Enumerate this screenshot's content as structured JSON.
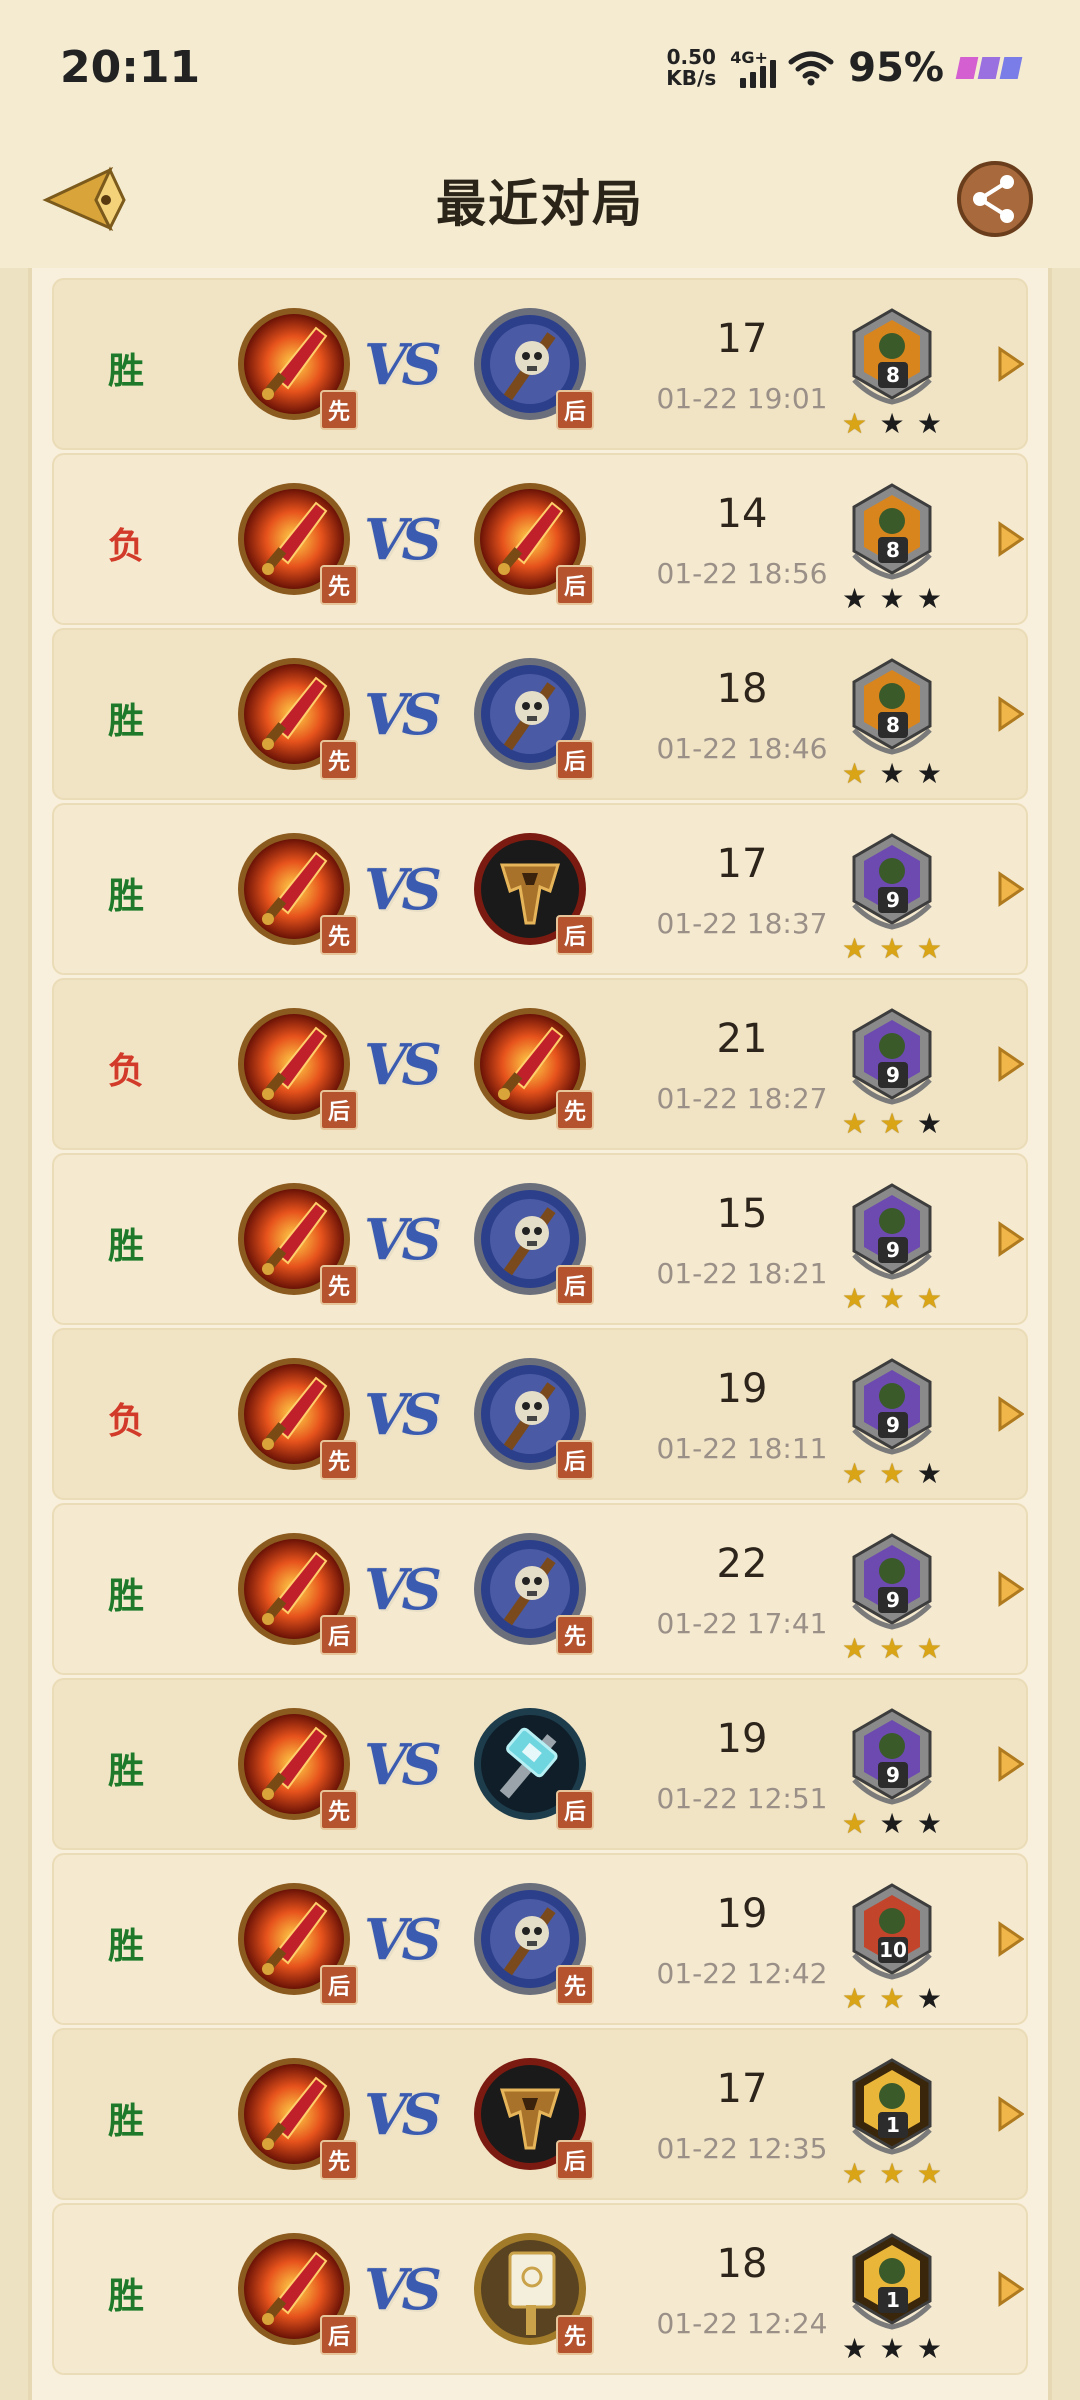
{
  "status_bar": {
    "time": "20:11",
    "speed_value": "0.50",
    "speed_unit": "KB/s",
    "network": "4G+",
    "battery": "95%"
  },
  "header": {
    "title": "最近对局",
    "back_icon": "back-arrow-icon",
    "share_icon": "share-icon"
  },
  "colors": {
    "win": "#1e7a2a",
    "loss": "#d23a2a",
    "star_gold": "#d9a516",
    "star_dark": "#1c1c1c"
  },
  "matches": [
    {
      "result": "胜",
      "my_hero": "fire-blade",
      "my_order": "先",
      "opp_hero": "skull-mace",
      "opp_order": "后",
      "turns": "17",
      "time": "01-22 19:01",
      "rank": "8",
      "rank_style": "orange",
      "stars": [
        1,
        0,
        0
      ]
    },
    {
      "result": "负",
      "my_hero": "fire-blade",
      "my_order": "先",
      "opp_hero": "fire-blade",
      "opp_order": "后",
      "turns": "14",
      "time": "01-22 18:56",
      "rank": "8",
      "rank_style": "orange",
      "stars": [
        0,
        0,
        0
      ]
    },
    {
      "result": "胜",
      "my_hero": "fire-blade",
      "my_order": "先",
      "opp_hero": "skull-mace",
      "opp_order": "后",
      "turns": "18",
      "time": "01-22 18:46",
      "rank": "8",
      "rank_style": "orange",
      "stars": [
        1,
        0,
        0
      ]
    },
    {
      "result": "胜",
      "my_hero": "fire-blade",
      "my_order": "先",
      "opp_hero": "horde-crest",
      "opp_order": "后",
      "turns": "17",
      "time": "01-22 18:37",
      "rank": "9",
      "rank_style": "purple",
      "stars": [
        1,
        1,
        1
      ]
    },
    {
      "result": "负",
      "my_hero": "fire-blade",
      "my_order": "后",
      "opp_hero": "fire-blade",
      "opp_order": "先",
      "turns": "21",
      "time": "01-22 18:27",
      "rank": "9",
      "rank_style": "purple",
      "stars": [
        1,
        1,
        0
      ]
    },
    {
      "result": "胜",
      "my_hero": "fire-blade",
      "my_order": "先",
      "opp_hero": "skull-mace",
      "opp_order": "后",
      "turns": "15",
      "time": "01-22 18:21",
      "rank": "9",
      "rank_style": "purple",
      "stars": [
        1,
        1,
        1
      ]
    },
    {
      "result": "负",
      "my_hero": "fire-blade",
      "my_order": "先",
      "opp_hero": "skull-mace",
      "opp_order": "后",
      "turns": "19",
      "time": "01-22 18:11",
      "rank": "9",
      "rank_style": "purple",
      "stars": [
        1,
        1,
        0
      ]
    },
    {
      "result": "胜",
      "my_hero": "fire-blade",
      "my_order": "后",
      "opp_hero": "skull-mace",
      "opp_order": "先",
      "turns": "22",
      "time": "01-22 17:41",
      "rank": "9",
      "rank_style": "purple",
      "stars": [
        1,
        1,
        1
      ]
    },
    {
      "result": "胜",
      "my_hero": "fire-blade",
      "my_order": "先",
      "opp_hero": "frost-hammer",
      "opp_order": "后",
      "turns": "19",
      "time": "01-22 12:51",
      "rank": "9",
      "rank_style": "purple",
      "stars": [
        1,
        0,
        0
      ]
    },
    {
      "result": "胜",
      "my_hero": "fire-blade",
      "my_order": "后",
      "opp_hero": "skull-mace",
      "opp_order": "先",
      "turns": "19",
      "time": "01-22 12:42",
      "rank": "10",
      "rank_style": "red",
      "stars": [
        1,
        1,
        0
      ]
    },
    {
      "result": "胜",
      "my_hero": "fire-blade",
      "my_order": "先",
      "opp_hero": "horde-crest",
      "opp_order": "后",
      "turns": "17",
      "time": "01-22 12:35",
      "rank": "1",
      "rank_style": "gold",
      "stars": [
        1,
        1,
        1
      ]
    },
    {
      "result": "胜",
      "my_hero": "fire-blade",
      "my_order": "后",
      "opp_hero": "holy-book",
      "opp_order": "先",
      "turns": "18",
      "time": "01-22 12:24",
      "rank": "1",
      "rank_style": "gold",
      "stars": [
        0,
        0,
        0
      ]
    }
  ]
}
